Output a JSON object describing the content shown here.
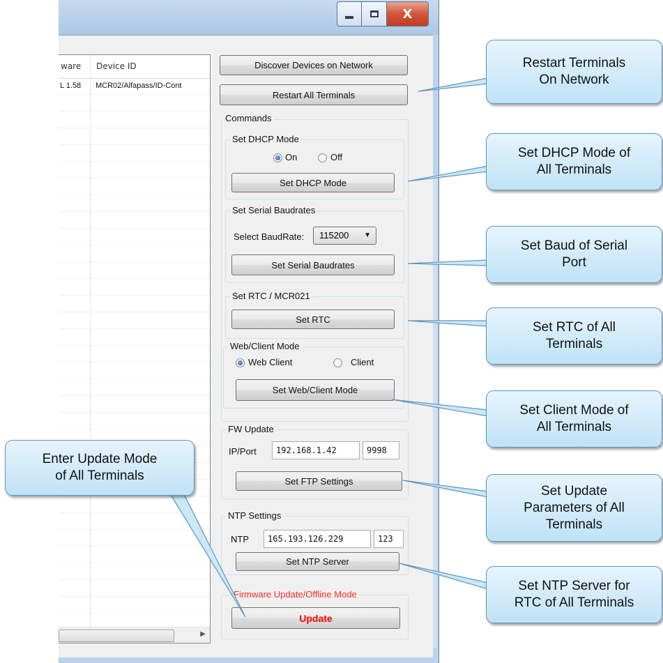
{
  "window": {
    "caption_buttons": {
      "minimize_icon": "minimize-icon",
      "maximize_icon": "maximize-icon",
      "close_glyph": "X"
    }
  },
  "device_list": {
    "columns": [
      "ware",
      "Device ID"
    ],
    "rows": [
      {
        "firmware": "L 1.58",
        "device_id": "MCR02/Alfapass/ID-Cont"
      }
    ]
  },
  "panel": {
    "discover_button": "Discover Devices on Network",
    "restart_button": "Restart All Terminals",
    "commands_group": "Commands",
    "dhcp": {
      "group": "Set DHCP Mode",
      "on_label": "On",
      "off_label": "Off",
      "selected": "On",
      "button": "Set DHCP Mode"
    },
    "baud": {
      "group": "Set Serial Baudrates",
      "label": "Select BaudRate:",
      "value": "115200",
      "button": "Set Serial Baudrates"
    },
    "rtc": {
      "group": "Set RTC / MCR021",
      "button": "Set RTC"
    },
    "web_client": {
      "group": "Web/Client Mode",
      "web_label": "Web Client",
      "client_label": "Client",
      "selected": "Web Client",
      "button": "Set Web/Client Mode"
    },
    "fw_update": {
      "group": "FW Update",
      "label": "IP/Port",
      "ip": "192.168.1.42",
      "port": "9998",
      "button": "Set FTP Settings"
    },
    "ntp": {
      "group": "NTP Settings",
      "label": "NTP",
      "server": "165.193.126.229",
      "port": "123",
      "button": "Set NTP Server"
    },
    "firmware_mode": {
      "group": "Firmware Update/Offline Mode",
      "button": "Update",
      "accent": "#ff0000"
    }
  },
  "callouts": {
    "restart": "Restart Terminals\nOn Network",
    "dhcp": "Set DHCP Mode of\nAll Terminals",
    "baud": "Set Baud of Serial\nPort",
    "rtc": "Set RTC of All\nTerminals",
    "client": "Set Client Mode of\nAll Terminals",
    "update_params": "Set Update\nParameters of All\nTerminals",
    "ntp": "Set NTP Server for\nRTC of All Terminals",
    "update_mode": "Enter Update Mode\nof All Terminals"
  },
  "colors": {
    "callout_fill": "#c6e6f7",
    "callout_border": "#5f94bd",
    "titlebar": "#bad2eb",
    "close_button": "#d2553a"
  }
}
